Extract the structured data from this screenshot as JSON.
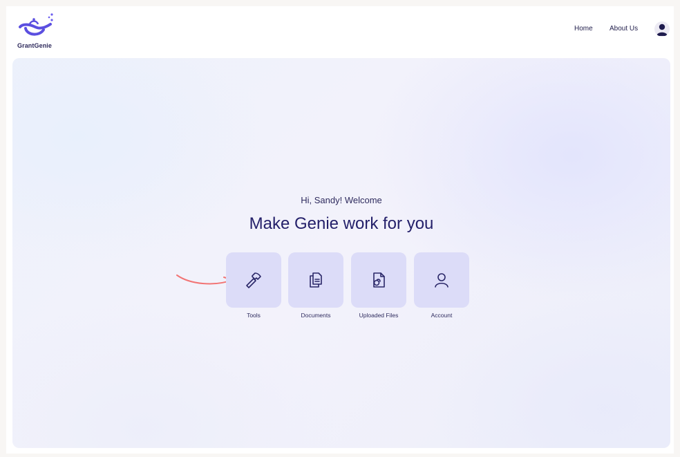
{
  "brand": {
    "name": "GrantGenie"
  },
  "nav": {
    "home": "Home",
    "about": "About Us"
  },
  "hero": {
    "greeting": "Hi, Sandy! Welcome",
    "headline": "Make Genie work for you"
  },
  "tiles": [
    {
      "label": "Tools",
      "icon": "hammer-icon"
    },
    {
      "label": "Documents",
      "icon": "documents-icon"
    },
    {
      "label": "Uploaded Files",
      "icon": "uploaded-file-icon"
    },
    {
      "label": "Account",
      "icon": "account-icon"
    }
  ],
  "colors": {
    "accent": "#5b4fe0",
    "tile_bg": "#dcdcf8",
    "text_dark": "#24206a",
    "arrow": "#f27474"
  }
}
